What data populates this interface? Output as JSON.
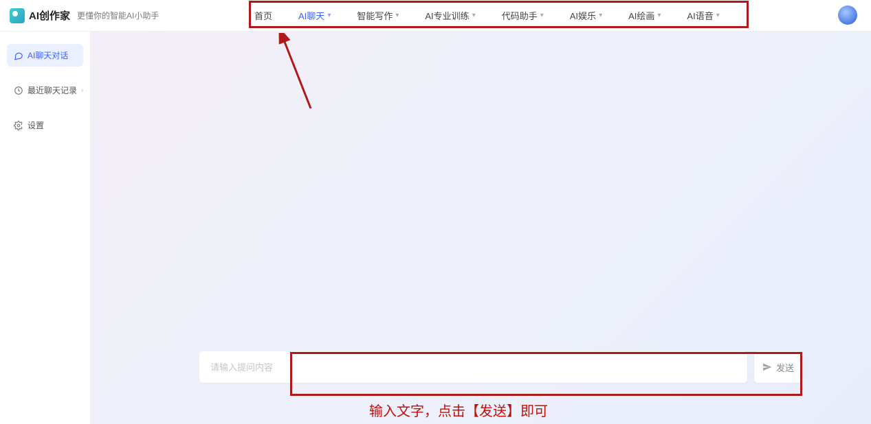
{
  "brand": {
    "name": "AI创作家",
    "tagline": "更懂你的智能AI小助手"
  },
  "nav": {
    "items": [
      {
        "label": "首页",
        "has_dropdown": false,
        "active": false
      },
      {
        "label": "AI聊天",
        "has_dropdown": true,
        "active": true
      },
      {
        "label": "智能写作",
        "has_dropdown": true,
        "active": false
      },
      {
        "label": "AI专业训练",
        "has_dropdown": true,
        "active": false
      },
      {
        "label": "代码助手",
        "has_dropdown": true,
        "active": false
      },
      {
        "label": "AI娱乐",
        "has_dropdown": true,
        "active": false
      },
      {
        "label": "AI绘画",
        "has_dropdown": true,
        "active": false
      },
      {
        "label": "AI语音",
        "has_dropdown": true,
        "active": false
      }
    ]
  },
  "sidebar": {
    "items": [
      {
        "icon": "chat-icon",
        "label": "AI聊天对话",
        "active": true,
        "expandable": false
      },
      {
        "icon": "history-icon",
        "label": "最近聊天记录",
        "active": false,
        "expandable": true
      },
      {
        "icon": "settings-icon",
        "label": "设置",
        "active": false,
        "expandable": false
      }
    ]
  },
  "chat": {
    "input_placeholder": "请输入提问内容",
    "send_label": "发送"
  },
  "annotations": {
    "instruction": "输入文字，点击【发送】即可"
  },
  "colors": {
    "accent": "#3b63ff",
    "annotation_red": "#b01919"
  }
}
